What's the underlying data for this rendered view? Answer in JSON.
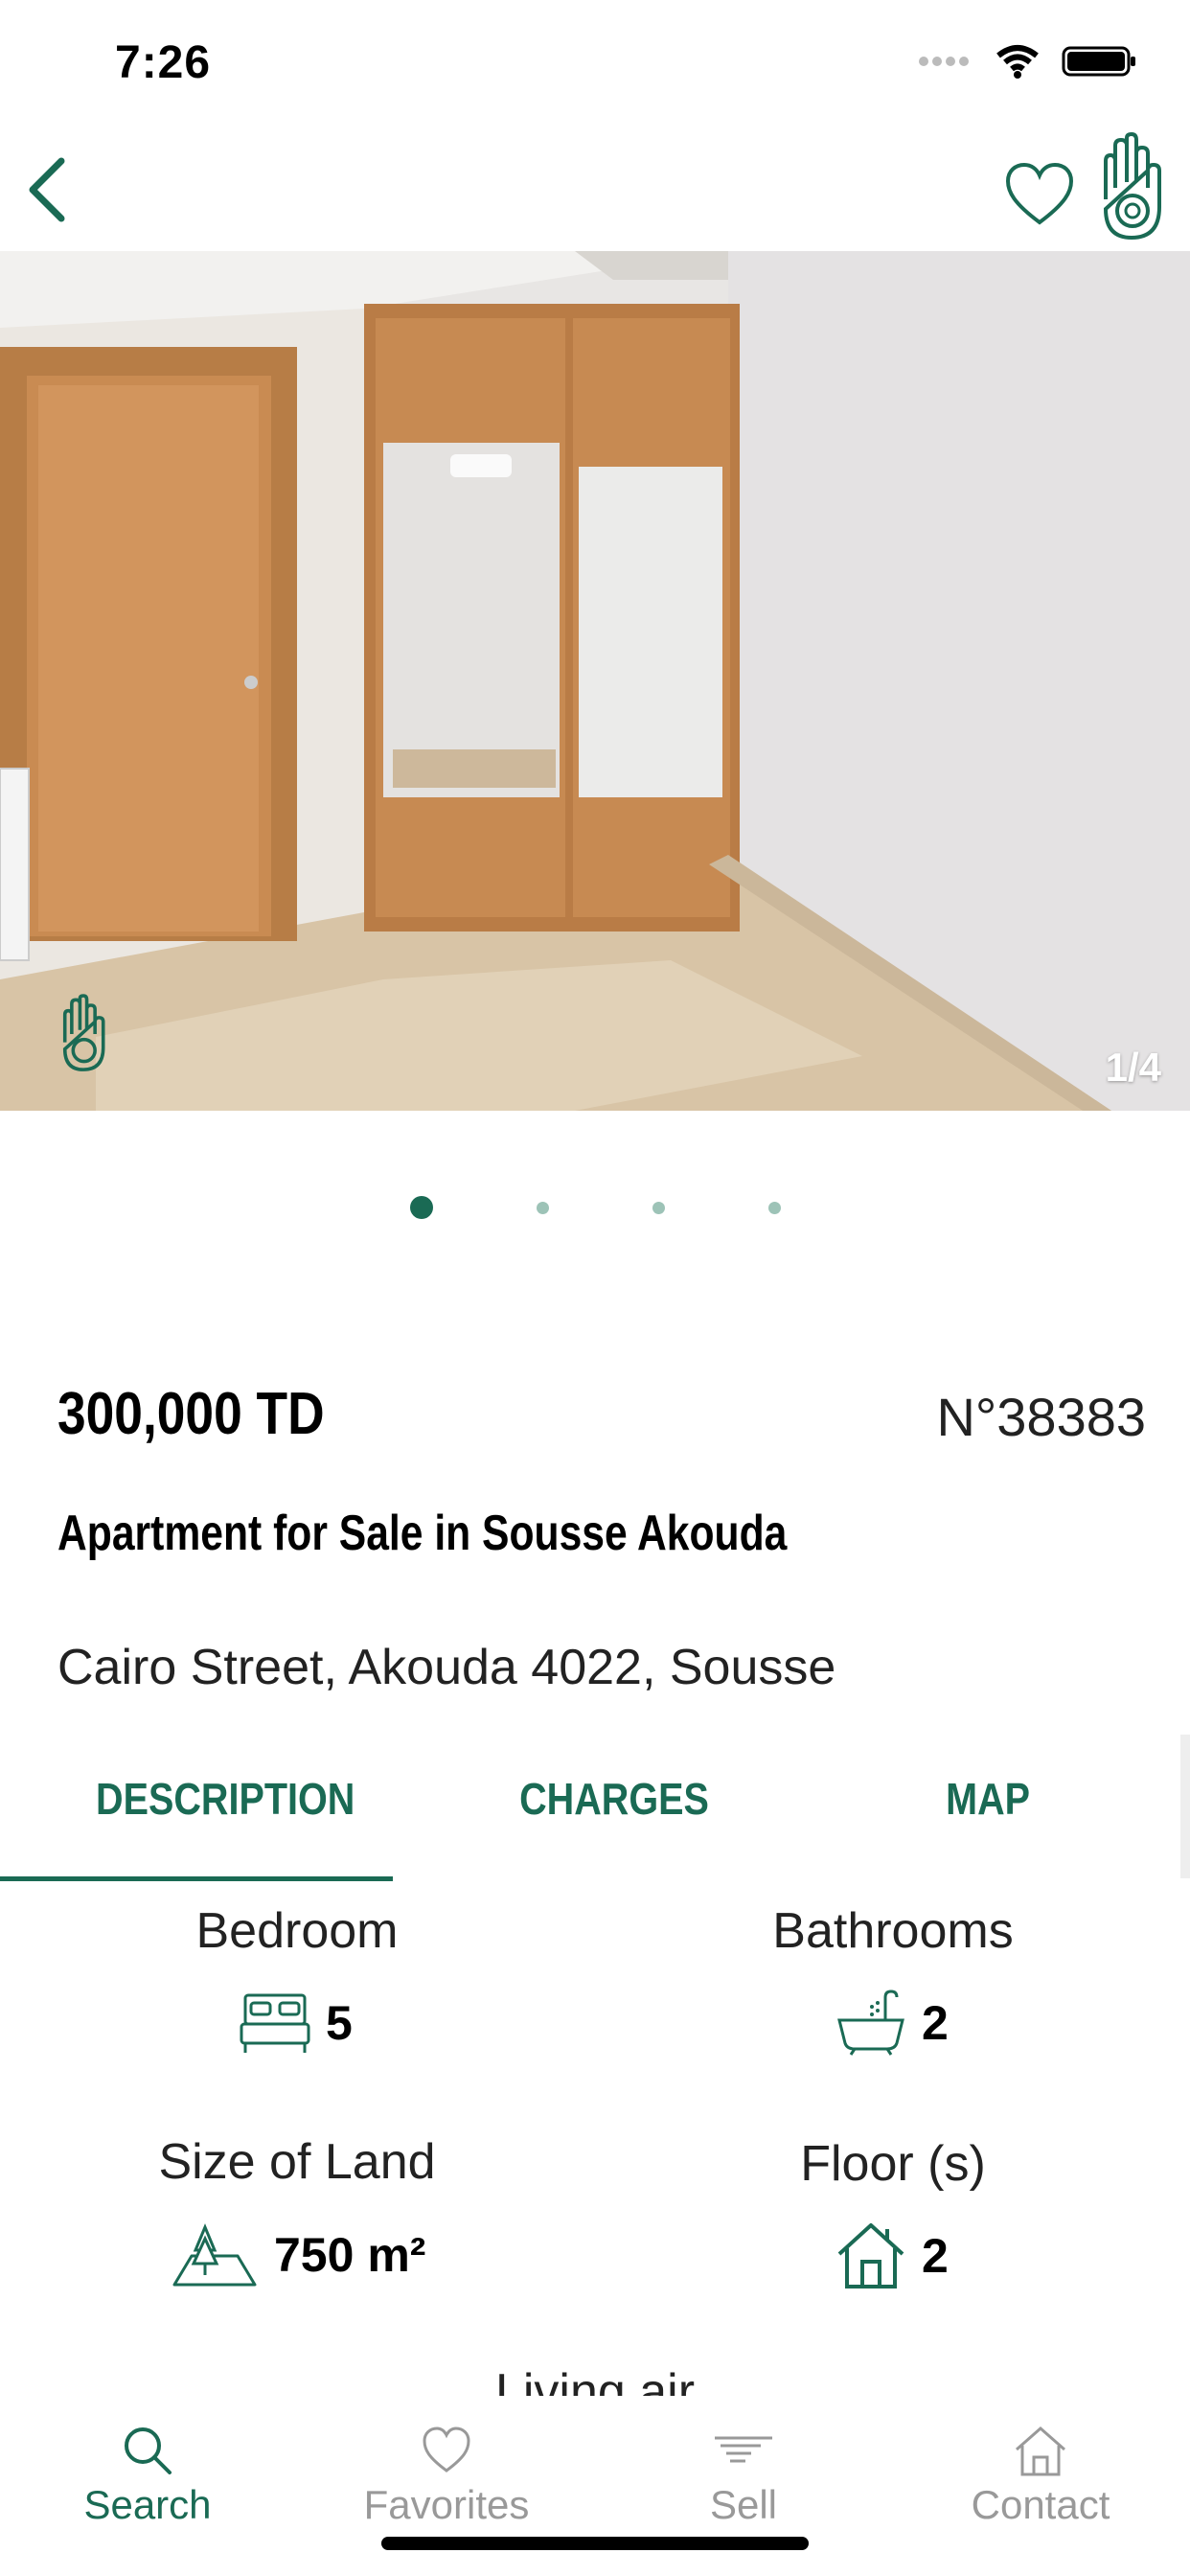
{
  "status": {
    "time": "7:26"
  },
  "listing": {
    "price": "300,000 TD",
    "reference": "N°38383",
    "title": "Apartment for Sale in Sousse Akouda",
    "address": "Cairo Street, Akouda 4022, Sousse",
    "photo_counter": "1/4",
    "photo_count": 4,
    "photo_index": 1
  },
  "tabs": [
    {
      "label": "DESCRIPTION",
      "active": true
    },
    {
      "label": "CHARGES",
      "active": false
    },
    {
      "label": "MAP",
      "active": false
    }
  ],
  "features": [
    {
      "label": "Bedroom",
      "value": "5",
      "icon": "bed-icon"
    },
    {
      "label": "Bathrooms",
      "value": "2",
      "icon": "bathtub-icon"
    },
    {
      "label": "Size of Land",
      "value": "750 m²",
      "icon": "land-icon"
    },
    {
      "label": "Floor (s)",
      "value": "2",
      "icon": "house-icon"
    }
  ],
  "partial_feature_label": "Living air",
  "tabbar": [
    {
      "label": "Search",
      "icon": "search-icon",
      "active": true
    },
    {
      "label": "Favorites",
      "icon": "heart-icon",
      "active": false
    },
    {
      "label": "Sell",
      "icon": "sell-icon",
      "active": false
    },
    {
      "label": "Contact",
      "icon": "contact-home-icon",
      "active": false
    }
  ],
  "colors": {
    "accent": "#1a6a54",
    "dot_inactive": "#9dc3b7",
    "tab_inactive": "#999999"
  }
}
